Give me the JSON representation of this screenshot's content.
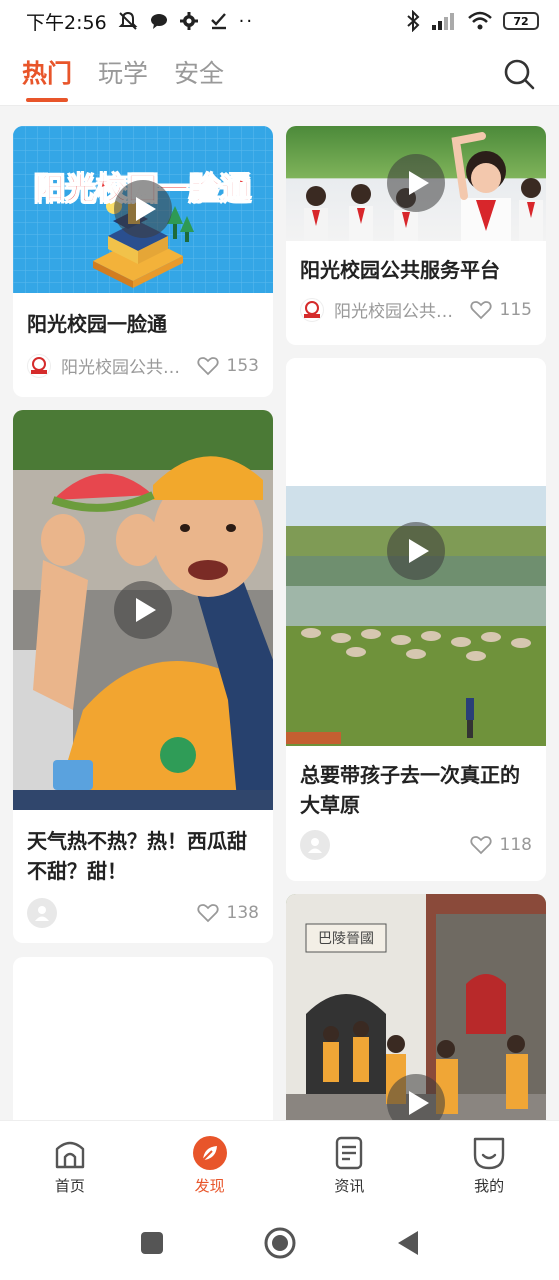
{
  "status_bar": {
    "time": "下午2:56",
    "battery": "72"
  },
  "tabs": [
    {
      "label": "热门",
      "active": true
    },
    {
      "label": "玩学",
      "active": false
    },
    {
      "label": "安全",
      "active": false
    }
  ],
  "cards": [
    {
      "title": "阳光校园一脸通",
      "author": "阳光校园公共服务平台",
      "likes": "153",
      "banner_text": "阳光校园一脸通"
    },
    {
      "title": "阳光校园公共服务平台",
      "author": "阳光校园公共服务平台",
      "likes": "115"
    },
    {
      "title": "天气热不热？热！西瓜甜不甜？甜！",
      "likes": "138"
    },
    {
      "title": "总要带孩子去一次真正的大草原",
      "likes": "118"
    },
    {
      "gate_sign": "巴陵晉國"
    }
  ],
  "bottom_nav": [
    {
      "label": "首页",
      "icon": "home-icon"
    },
    {
      "label": "发现",
      "icon": "discover-icon",
      "active": true
    },
    {
      "label": "资讯",
      "icon": "news-icon"
    },
    {
      "label": "我的",
      "icon": "profile-icon"
    }
  ],
  "colors": {
    "accent": "#e8552a",
    "background": "#f4f4f4"
  }
}
